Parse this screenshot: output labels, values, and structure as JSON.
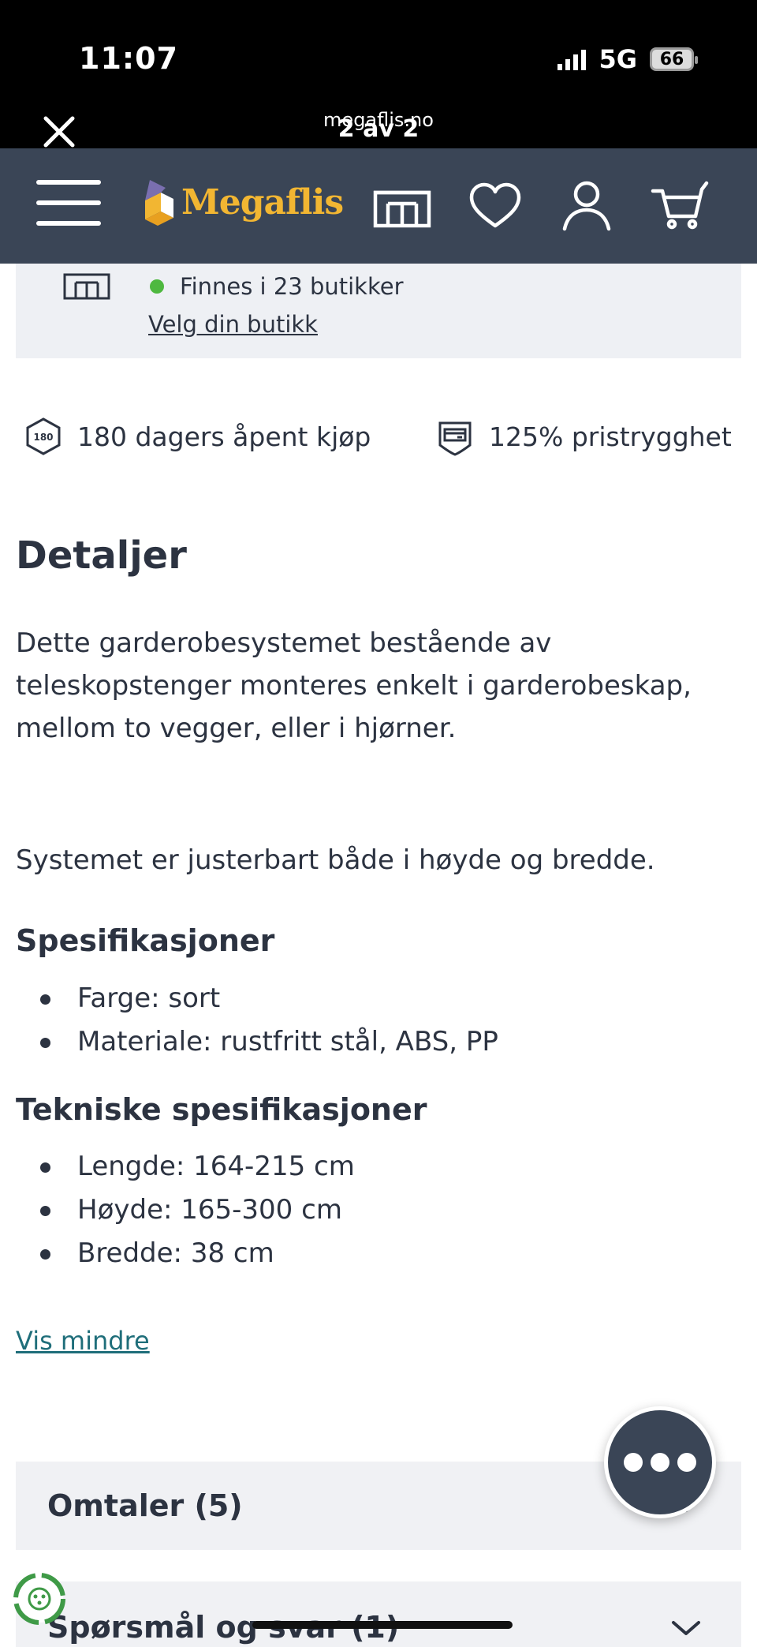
{
  "status": {
    "time": "11:07",
    "network": "5G",
    "battery": "66"
  },
  "viewer": {
    "domain": "megaflis.no",
    "counter": "2 av 2"
  },
  "header": {
    "brand": "Megaflis",
    "colors": {
      "background": "#3a4556",
      "brand_yellow": "#f2b632"
    },
    "icons": [
      "menu-icon",
      "store-icon",
      "heart-icon",
      "user-icon",
      "cart-icon"
    ]
  },
  "store": {
    "availability": "Finnes i 23 butikker",
    "link": "Velg din butikk",
    "badge": "180"
  },
  "usps": {
    "open_purchase": "180 dagers åpent kjøp",
    "price_guarantee": "125% pristrygghet"
  },
  "details": {
    "title": "Detaljer",
    "paragraph1": "Dette garderobesystemet bestående av teleskopstenger monteres enkelt i garderobeskap, mellom to vegger, eller i hjørner.",
    "paragraph2": "Systemet er justerbart både i høyde og bredde.",
    "specs_title": "Spesifikasjoner",
    "specs": [
      "Farge: sort",
      "Materiale: rustfritt stål, ABS, PP"
    ],
    "tech_title": "Tekniske spesifikasjoner",
    "tech": [
      "Lengde: 164-215 cm",
      "Høyde: 165-300 cm",
      "Bredde: 38 cm"
    ],
    "toggle": "Vis mindre"
  },
  "accordions": {
    "reviews": "Omtaler (5)",
    "qa": "Spørsmål og svar (1)"
  }
}
